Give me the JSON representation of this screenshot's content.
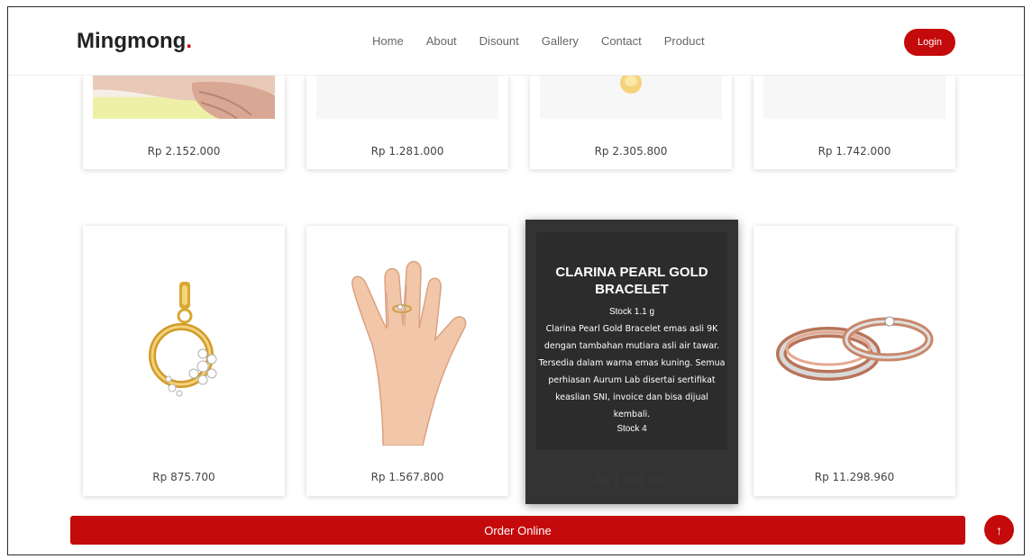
{
  "brand": {
    "name": "Mingmong",
    "dot": "."
  },
  "nav": {
    "items": [
      {
        "label": "Home"
      },
      {
        "label": "About"
      },
      {
        "label": "Disount"
      },
      {
        "label": "Gallery"
      },
      {
        "label": "Contact"
      },
      {
        "label": "Product"
      }
    ],
    "login_label": "Login"
  },
  "products_top": [
    {
      "price": "Rp 2.152.000"
    },
    {
      "price": "Rp 1.281.000"
    },
    {
      "price": "Rp 2.305.800"
    },
    {
      "price": "Rp 1.742.000"
    }
  ],
  "products_bottom": [
    {
      "price": "Rp 875.700"
    },
    {
      "price": "Rp 1.567.800"
    },
    {
      "price": "Rp 1.281.000",
      "title": "CLARINA PEARL GOLD BRACELET",
      "stock_weight": "Stock 1.1 g",
      "description": "Clarina Pearl Gold Bracelet emas asli 9K dengan tambahan mutiara asli air tawar. Tersedia dalam warna emas kuning. Semua perhiasan Aurum Lab disertai sertifikat keaslian SNI, invoice dan bisa dijual kembali.",
      "stock_count": "Stock 4"
    },
    {
      "price": "Rp 11.298.960"
    }
  ],
  "order_label": "Order Online",
  "back_to_top_icon": "↑",
  "colors": {
    "accent": "#c40a0a",
    "overlay": "#333333"
  }
}
